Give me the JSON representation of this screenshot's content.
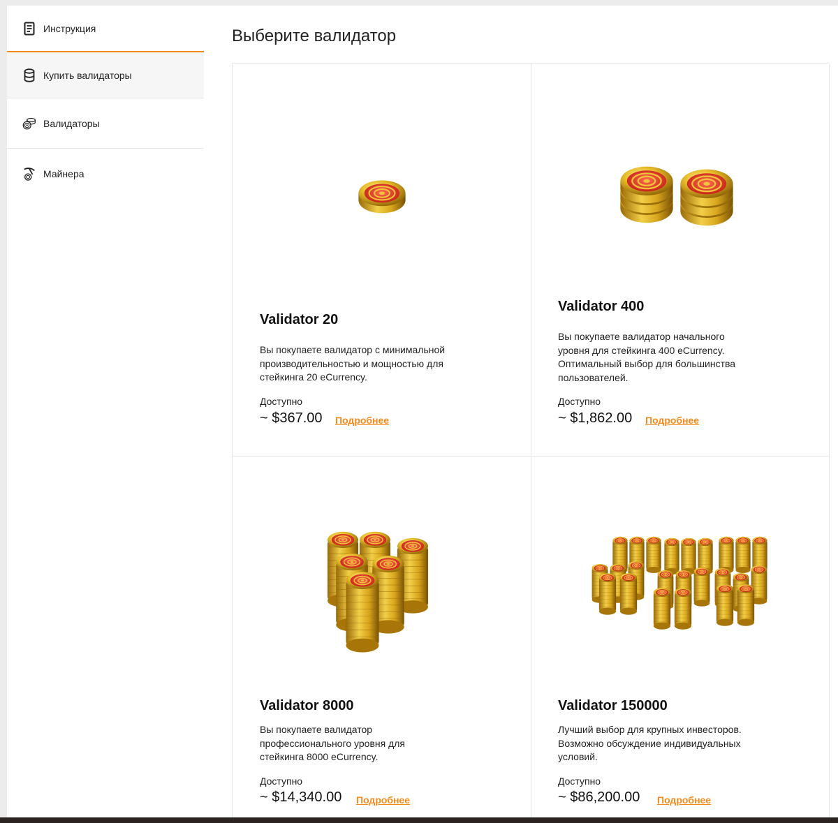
{
  "sidebar": {
    "items": [
      {
        "label": "Инструкция",
        "icon": "document-icon"
      },
      {
        "label": "Купить валидаторы",
        "icon": "database-icon"
      },
      {
        "label": "Валидаторы",
        "icon": "coins-icon"
      },
      {
        "label": "Майнера",
        "icon": "pickaxe-icon"
      }
    ]
  },
  "main": {
    "title": "Выберите валидатор",
    "cards": [
      {
        "name": "Validator 20",
        "desc": "Вы покупаете валидатор с минимальной производительностью и мощностью для стейкинга 20 eCurrency.",
        "avail": "Доступно",
        "price": "~ $367.00",
        "more": "Подробнее"
      },
      {
        "name": "Validator 400",
        "desc": "Вы покупаете валидатор начального уровня для стейкинга 400 eCurrency. Оптимальный выбор для большинства пользователей.",
        "avail": "Доступно",
        "price": "~ $1,862.00",
        "more": "Подробнее"
      },
      {
        "name": "Validator 8000",
        "desc": "Вы покупаете валидатор профессионального уровня для стейкинга 8000 eCurrency.",
        "avail": "Доступно",
        "price": "~ $14,340.00",
        "more": "Подробнее"
      },
      {
        "name": "Validator 150000",
        "desc": "Лучший выбор для крупных инвесторов. Возможно обсуждение индивидуальных условий.",
        "avail": "Доступно",
        "price": "~ $86,200.00",
        "more": "Подробнее"
      }
    ]
  },
  "colors": {
    "accent": "#f28b1c",
    "coin_gold": "#d9a81c",
    "coin_red": "#e03a2a"
  }
}
